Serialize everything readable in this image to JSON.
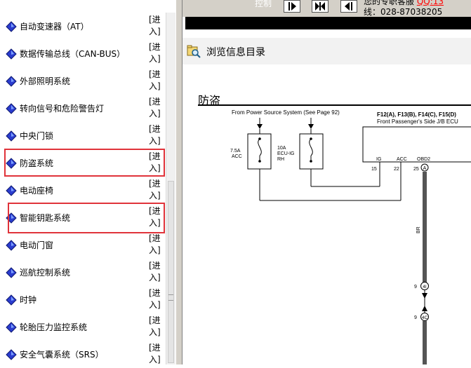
{
  "sidebar": {
    "enter_label": "[进入]",
    "items": [
      {
        "label": "自动变速器（AT）"
      },
      {
        "label": "数据传输总线（CAN-BUS）"
      },
      {
        "label": "外部照明系统"
      },
      {
        "label": "转向信号和危险警告灯"
      },
      {
        "label": "中央门锁"
      },
      {
        "label": "防盗系统",
        "highlighted": true
      },
      {
        "label": "电动座椅"
      },
      {
        "label": "智能钥匙系统",
        "highlighted": true
      },
      {
        "label": "电动门窗"
      },
      {
        "label": "巡航控制系统"
      },
      {
        "label": "时钟"
      },
      {
        "label": "轮胎压力监控系统"
      },
      {
        "label": "安全气囊系统（SRS）"
      }
    ]
  },
  "toolbar": {
    "control_label": "控制",
    "customer_service": "您的专职客服",
    "qq": "QQ:13",
    "hotline": "线：028-87038205",
    "nav_buttons": [
      "play-right-icon",
      "step-icon",
      "play-left-icon"
    ]
  },
  "browse": {
    "title": "浏览信息目录"
  },
  "diagram": {
    "title": "防盗",
    "power_source_note": "From Power Source System (See Page 92)",
    "ecu_header": "F12(A), F13(B), F14(C), F15(D)",
    "ecu_name": "Front Passenger's Side J/B ECU",
    "fuse1_amps": "7.5A",
    "fuse1_name": "ACC",
    "fuse2_amps": "10A",
    "fuse2_name1": "ECU-IG",
    "fuse2_name2": "RH",
    "pin_ig": "IG",
    "pin_acc": "ACC",
    "pin_obd2": "OBD2",
    "pin15": "15",
    "pin22": "22",
    "pin25": "25",
    "conn_a": "A",
    "wire_color": "BR",
    "c9a": "9",
    "conn_4i": "4I",
    "c9b": "9",
    "conn_4c": "4C",
    "colors": {
      "highlight": "#e0333a",
      "wire": "#555555",
      "qq_link": "#ff0000"
    }
  }
}
